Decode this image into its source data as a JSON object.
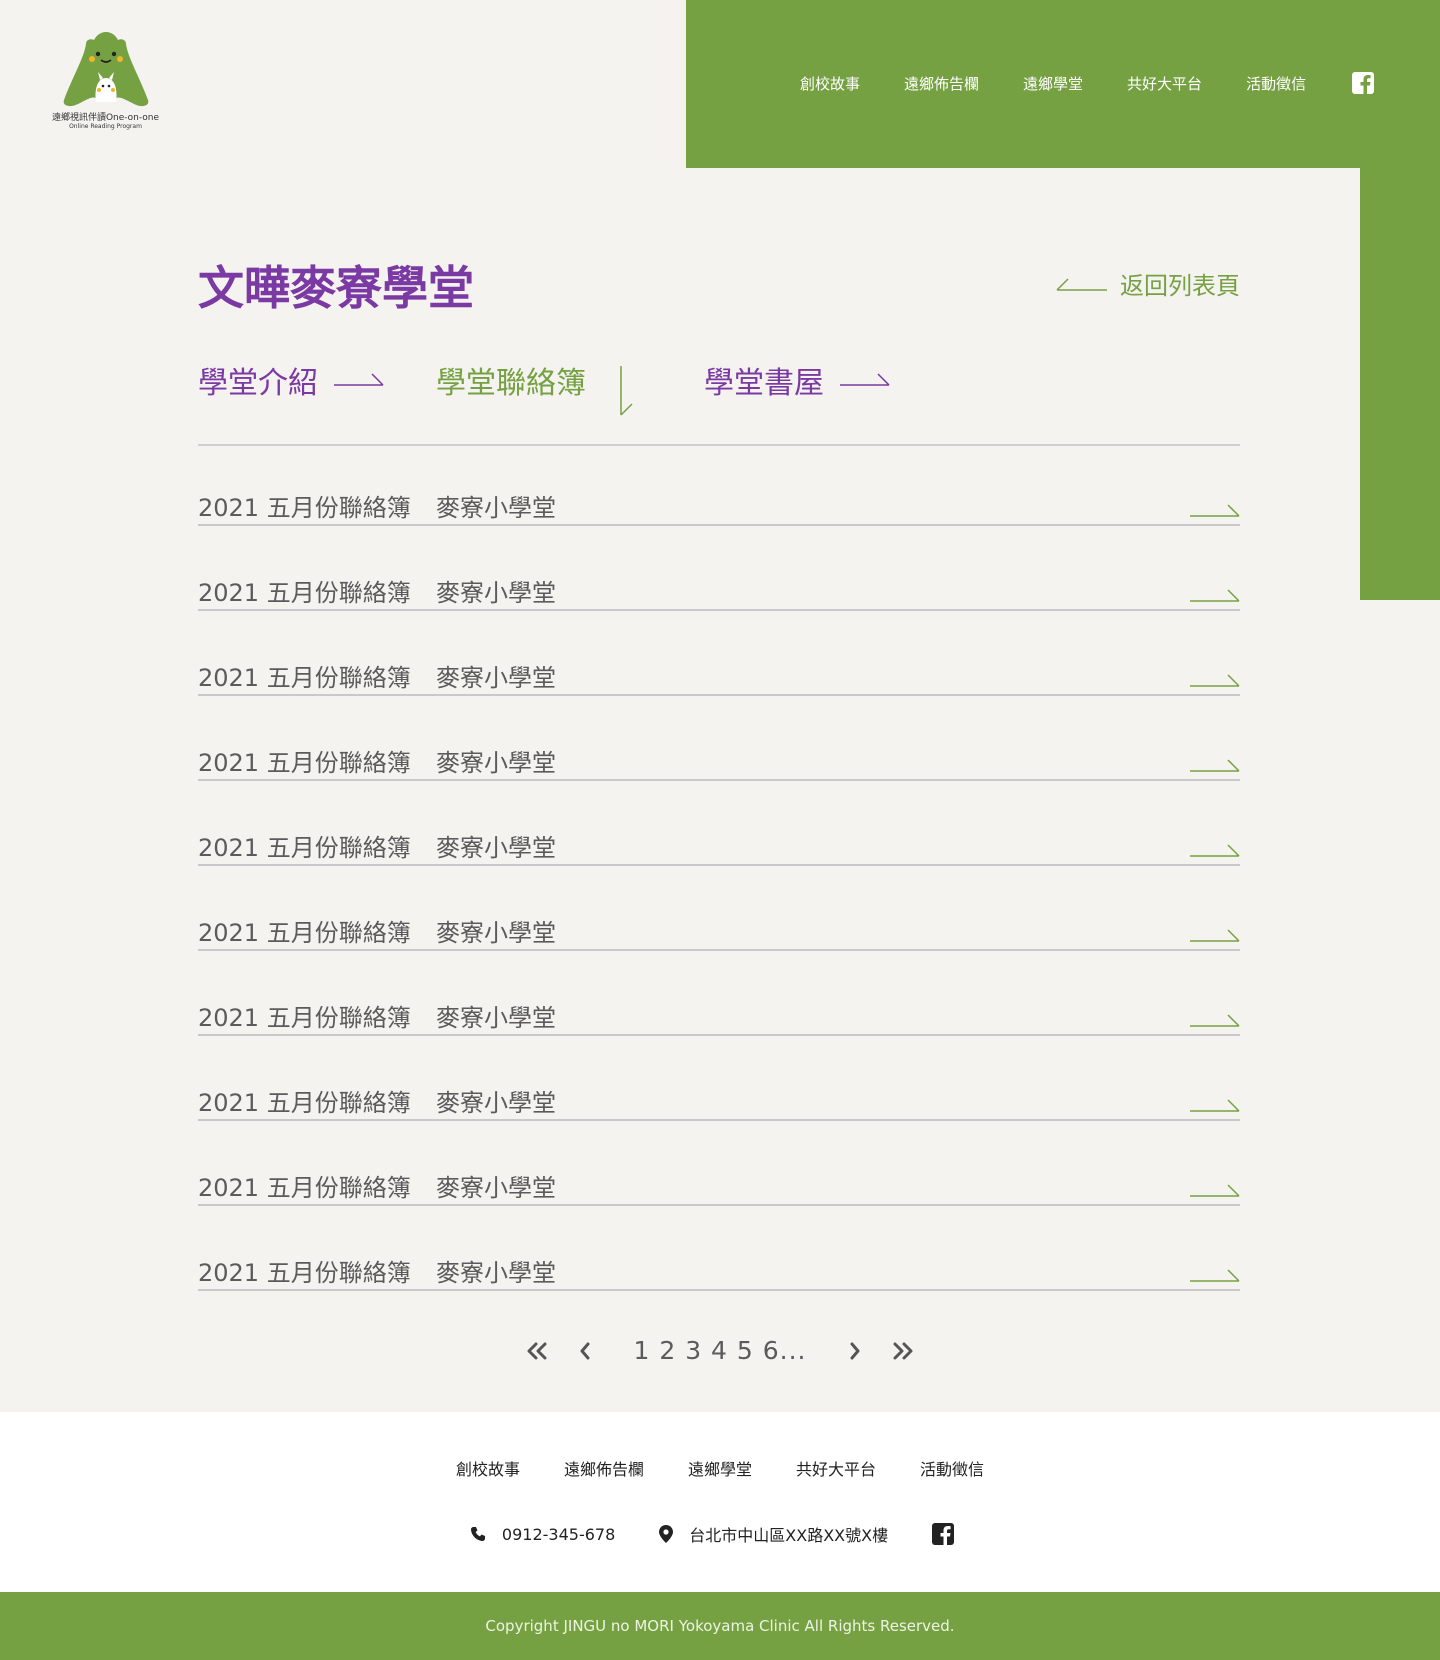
{
  "brand": {
    "name": "遠鄉視訊伴讀One-on-one",
    "tagline": "Online Reading Program",
    "green": "#76a142",
    "purple": "#7b3aa3"
  },
  "nav": {
    "items": [
      "創校故事",
      "遠鄉佈告欄",
      "遠鄉學堂",
      "共好大平台",
      "活動徵信"
    ],
    "social_icon": "facebook-icon"
  },
  "page": {
    "title": "文曄麥寮學堂",
    "back_label": "返回列表頁"
  },
  "tabs": [
    {
      "label": "學堂介紹",
      "active": false
    },
    {
      "label": "學堂聯絡簿",
      "active": true
    },
    {
      "label": "學堂書屋",
      "active": false
    }
  ],
  "entries": [
    {
      "title": "2021 五月份聯絡簿",
      "school": "麥寮小學堂"
    },
    {
      "title": "2021 五月份聯絡簿",
      "school": "麥寮小學堂"
    },
    {
      "title": "2021 五月份聯絡簿",
      "school": "麥寮小學堂"
    },
    {
      "title": "2021 五月份聯絡簿",
      "school": "麥寮小學堂"
    },
    {
      "title": "2021 五月份聯絡簿",
      "school": "麥寮小學堂"
    },
    {
      "title": "2021 五月份聯絡簿",
      "school": "麥寮小學堂"
    },
    {
      "title": "2021 五月份聯絡簿",
      "school": "麥寮小學堂"
    },
    {
      "title": "2021 五月份聯絡簿",
      "school": "麥寮小學堂"
    },
    {
      "title": "2021 五月份聯絡簿",
      "school": "麥寮小學堂"
    },
    {
      "title": "2021 五月份聯絡簿",
      "school": "麥寮小學堂"
    }
  ],
  "pagination": {
    "pages": "1 2 3 4 5 6..."
  },
  "footer": {
    "nav": [
      "創校故事",
      "遠鄉佈告欄",
      "遠鄉學堂",
      "共好大平台",
      "活動徵信"
    ],
    "phone": "0912-345-678",
    "address": "台北市中山區XX路XX號X樓",
    "copyright": "Copyright JINGU no MORI Yokoyama Clinic All Rights Reserved."
  }
}
